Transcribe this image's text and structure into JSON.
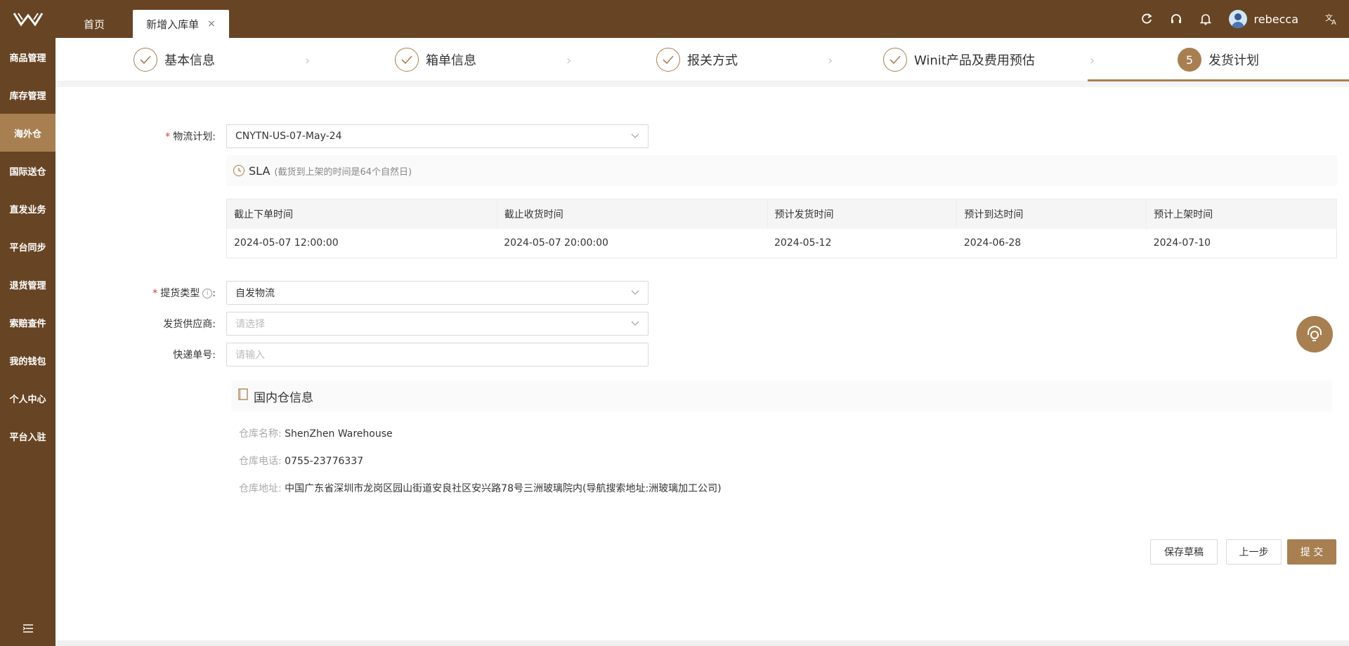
{
  "header": {
    "tabs": [
      {
        "label": "首页"
      },
      {
        "label": "新增入库单"
      }
    ],
    "close_symbol": "×",
    "username": "rebecca",
    "icons": [
      "refresh-icon",
      "headset-icon",
      "bell-icon",
      "translate-icon"
    ]
  },
  "sidebar": {
    "items": [
      {
        "label": "商品管理"
      },
      {
        "label": "库存管理"
      },
      {
        "label": "海外仓",
        "active": true
      },
      {
        "label": "国际送仓"
      },
      {
        "label": "直发业务"
      },
      {
        "label": "平台同步"
      },
      {
        "label": "退货管理"
      },
      {
        "label": "索赔查件"
      },
      {
        "label": "我的钱包"
      },
      {
        "label": "个人中心"
      },
      {
        "label": "平台入驻"
      }
    ]
  },
  "steps": [
    {
      "label": "基本信息",
      "status": "done"
    },
    {
      "label": "箱单信息",
      "status": "done"
    },
    {
      "label": "报关方式",
      "status": "done"
    },
    {
      "label": "Winit产品及费用预估",
      "status": "done"
    },
    {
      "label": "发货计划",
      "status": "current",
      "number": "5"
    }
  ],
  "form": {
    "logistics_plan": {
      "label": "物流计划",
      "value": "CNYTN-US-07-May-24"
    },
    "sla": {
      "title": "SLA",
      "note": "(截货到上架的时间是64个自然日)"
    },
    "sla_table": {
      "headers": [
        "截止下单时间",
        "截止收货时间",
        "预计发货时间",
        "预计到达时间",
        "预计上架时间"
      ],
      "row": [
        "2024-05-07 12:00:00",
        "2024-05-07 20:00:00",
        "2024-05-12",
        "2024-06-28",
        "2024-07-10"
      ]
    },
    "pickup_type": {
      "label": "提货类型",
      "value": "自发物流"
    },
    "supplier": {
      "label": "发货供应商",
      "placeholder": "请选择"
    },
    "tracking_no": {
      "label": "快递单号",
      "placeholder": "请输入"
    },
    "colon": ":"
  },
  "warehouse": {
    "title": "国内仓信息",
    "name_label": "仓库名称:",
    "name": "ShenZhen Warehouse",
    "phone_label": "仓库电话:",
    "phone": "0755-23776337",
    "address_label": "仓库地址:",
    "address": "中国广东省深圳市龙岗区园山街道安良社区安兴路78号三洲玻璃院内(导航搜索地址:洲玻璃加工公司)"
  },
  "buttons": {
    "save_draft": "保存草稿",
    "prev": "上一步",
    "submit": "提 交"
  },
  "colors": {
    "brand_dark": "#674423",
    "brand_accent": "#a87f51",
    "required": "#e3342f"
  }
}
